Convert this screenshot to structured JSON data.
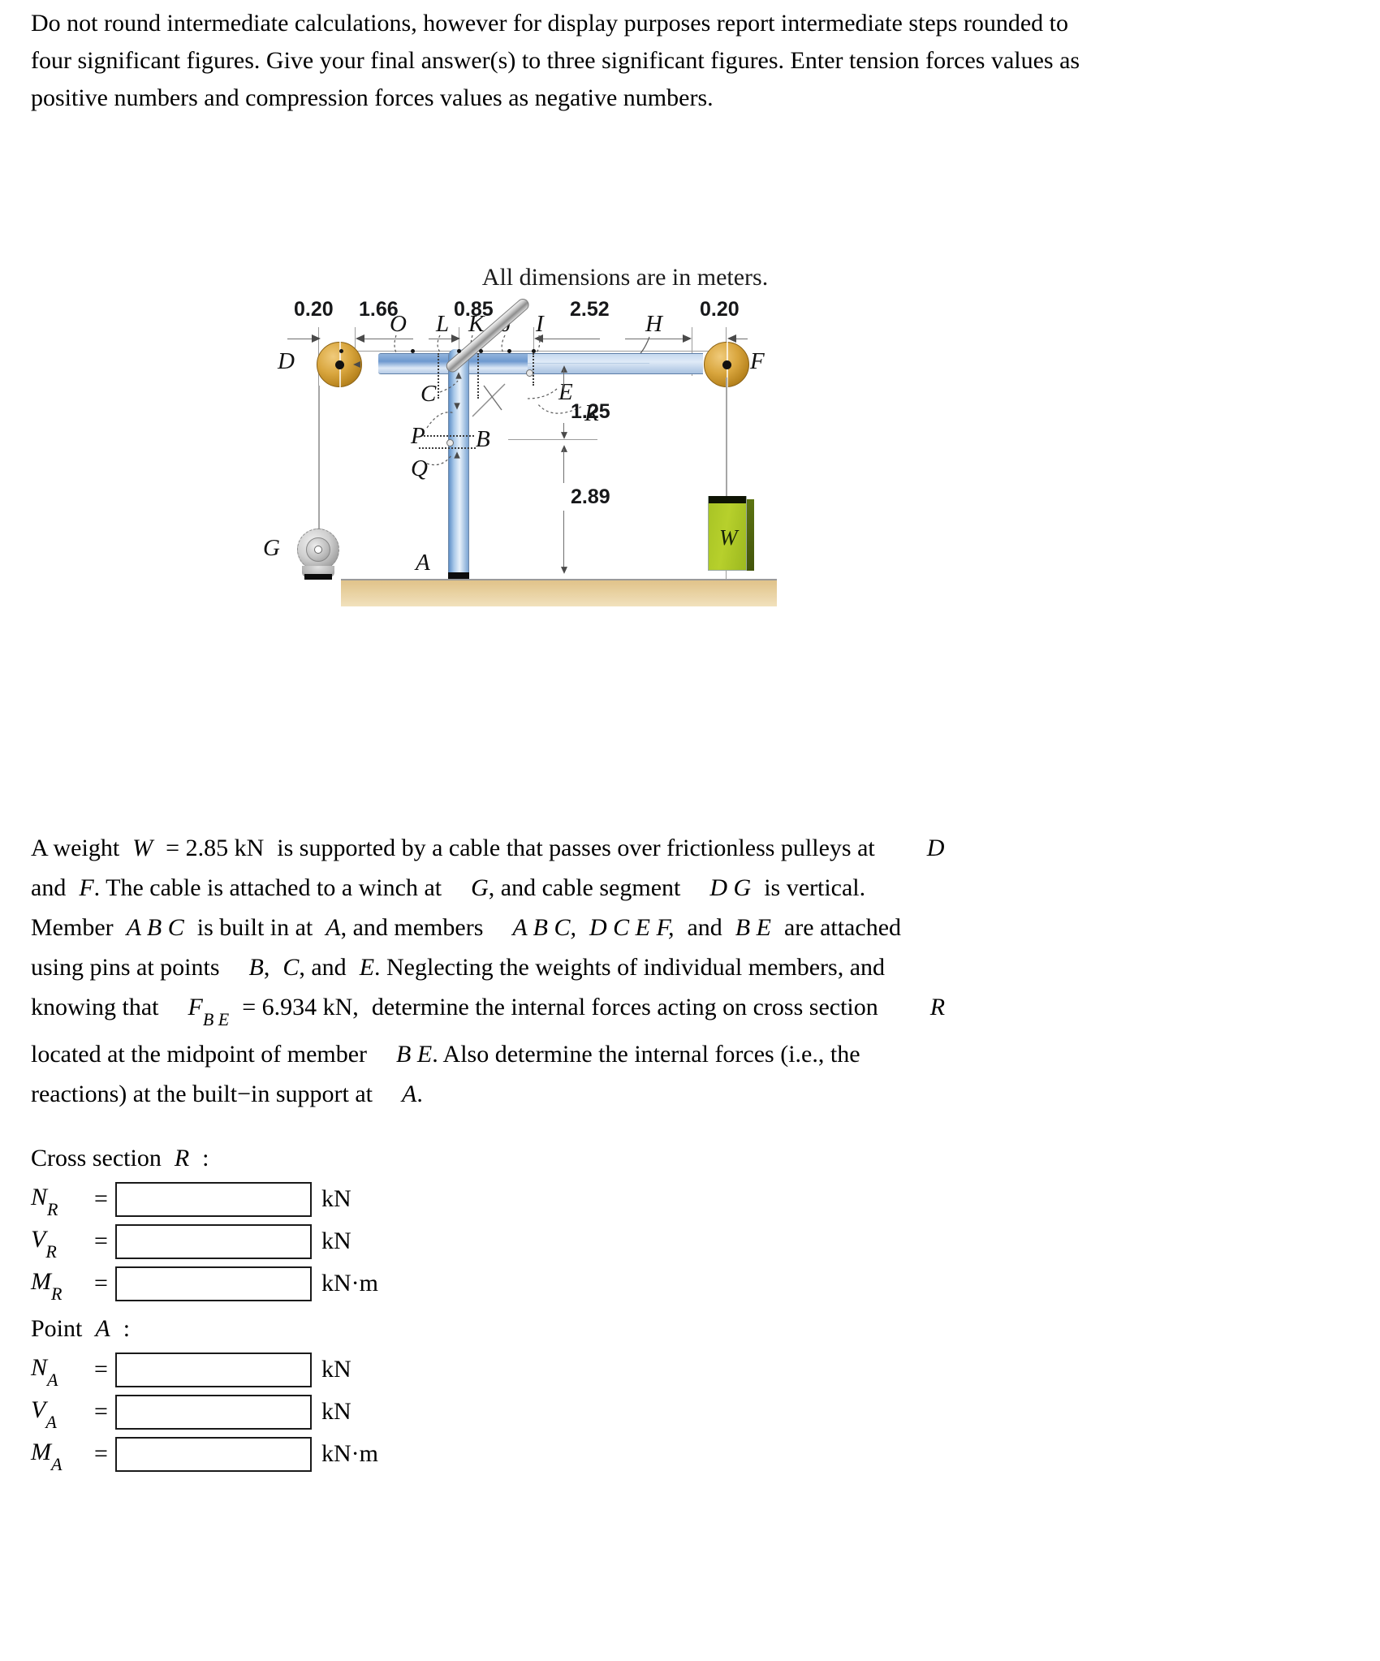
{
  "intro": {
    "text": "Do not round intermediate calculations, however for display purposes report intermediate steps rounded to four significant figures. Give your final answer(s) to three significant figures. Enter tension forces values as positive numbers and compression forces values as negative numbers."
  },
  "figure": {
    "caption": "All dimensions are in meters.",
    "horizontal_dimensions": [
      {
        "label": "0.20"
      },
      {
        "label": "1.66"
      },
      {
        "label": "0.85"
      },
      {
        "label": "2.52"
      },
      {
        "label": "0.20"
      }
    ],
    "vertical_dimensions": [
      {
        "label": "1.25"
      },
      {
        "label": "2.89"
      }
    ],
    "points": [
      {
        "label": "O"
      },
      {
        "label": "L"
      },
      {
        "label": "K"
      },
      {
        "label": "J"
      },
      {
        "label": "I"
      },
      {
        "label": "H"
      },
      {
        "label": "D"
      },
      {
        "label": "F"
      },
      {
        "label": "C"
      },
      {
        "label": "E"
      },
      {
        "label": "R"
      },
      {
        "label": "P"
      },
      {
        "label": "B"
      },
      {
        "label": "Q"
      },
      {
        "label": "G"
      },
      {
        "label": "A"
      }
    ],
    "weight_label": "W",
    "colors": {
      "beam": "#6e99cf",
      "column": "#7ba5d4",
      "pulley": "#d9a63e",
      "weight": "#b7d02c",
      "ground": "#e7cf9d",
      "diagonal": "#c9c9c9",
      "dimension_text": "#17181a"
    }
  },
  "problem": {
    "line1_a": "A weight",
    "line1_w": "W",
    "line1_b": "= 2.85 kN",
    "line1_c": "is supported by a cable that passes over frictionless pulleys at",
    "line1_d": "D",
    "line2_a": "and",
    "line2_f": "F",
    "line2_b": ". The cable is attached to a winch at",
    "line2_g": "G",
    "line2_c": ", and cable segment",
    "line2_dg": "D G",
    "line2_d": "is vertical.",
    "line3_a": "Member",
    "line3_abc": "A B C",
    "line3_b": "is built in at",
    "line3_A": "A",
    "line3_c": ", and members",
    "line3_m1": "A B C,",
    "line3_m2": "D C E F,",
    "line3_d": "and",
    "line3_m3": "B E",
    "line3_e": "are attached",
    "line4_a": "using pins at points",
    "line4_B": "B",
    "line4_b": ",",
    "line4_C": "C",
    "line4_c": ", and",
    "line4_E": "E",
    "line4_d": ". Neglecting the weights of individual members, and",
    "line5_a": "knowing that",
    "line5_f": "F",
    "line5_fsub": "B E",
    "line5_b": "= 6.934 kN,",
    "line5_c": "determine the internal forces acting on cross section",
    "line5_R": "R",
    "line6_a": "located at the midpoint of member",
    "line6_be": "B E",
    "line6_b": ". Also determine the internal forces (i.e., the",
    "line7_a": "reactions) at the built−in support at",
    "line7_A": "A",
    "line7_b": "."
  },
  "answers": {
    "section_r_heading_a": "Cross section",
    "section_r_heading_b": "R",
    "section_r_heading_c": ":",
    "section_a_heading_a": "Point",
    "section_a_heading_b": "A",
    "section_a_heading_c": ":",
    "rows": [
      {
        "symbol": "N",
        "subscript": "R",
        "equals": "=",
        "value": "",
        "unit": "kN"
      },
      {
        "symbol": "V",
        "subscript": "R",
        "equals": "=",
        "value": "",
        "unit": "kN"
      },
      {
        "symbol": "M",
        "subscript": "R",
        "equals": "=",
        "value": "",
        "unit": "kN·m"
      },
      {
        "symbol": "N",
        "subscript": "A",
        "equals": "=",
        "value": "",
        "unit": "kN"
      },
      {
        "symbol": "V",
        "subscript": "A",
        "equals": "=",
        "value": "",
        "unit": "kN"
      },
      {
        "symbol": "M",
        "subscript": "A",
        "equals": "=",
        "value": "",
        "unit": "kN·m"
      }
    ]
  }
}
